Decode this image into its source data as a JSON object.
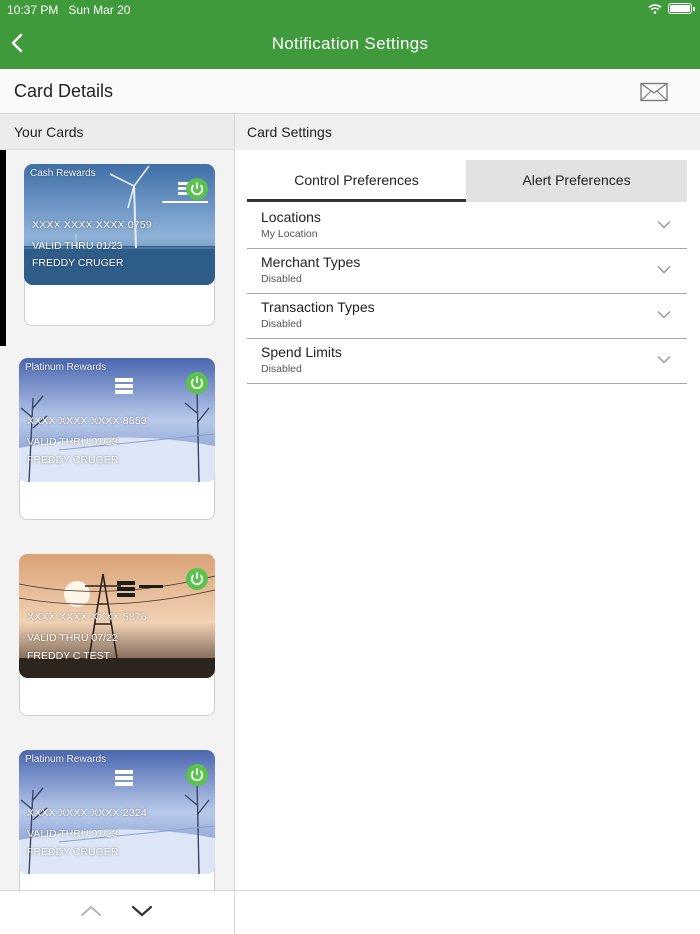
{
  "status_bar": {
    "time": "10:37 PM",
    "date": "Sun Mar 20"
  },
  "nav": {
    "title": "Notification Settings",
    "back_icon": "chevron-left-icon"
  },
  "details": {
    "title": "Card Details",
    "mail_icon": "mail-icon"
  },
  "left": {
    "heading": "Your Cards",
    "cards": [
      {
        "label": "Cash Rewards",
        "number": "XXXX XXXX XXXX 0759",
        "valid": "VALID THRU 01/23",
        "name": "FREDDY CRUGER",
        "theme": "wind-turbine",
        "selected": true
      },
      {
        "label": "Platinum Rewards",
        "number": "XXXX XXXX XXXX 8853",
        "valid": "VALID THRU 01/23",
        "name": "FREDDY CRUGER",
        "theme": "winter",
        "selected": false
      },
      {
        "label": "",
        "number": "XXXX XXXX XXXX 5876",
        "valid": "VALID THRU 07/22",
        "name": "FREDDY C TEST",
        "theme": "power-lines",
        "selected": false
      },
      {
        "label": "Platinum Rewards",
        "number": "XXXX XXXX XXXX 2324",
        "valid": "VALID THRU 01/23",
        "name": "FREDDY CRUGER",
        "theme": "winter",
        "selected": false
      }
    ],
    "footer_icons": [
      "chevron-up-icon",
      "chevron-down-icon"
    ]
  },
  "right": {
    "heading": "Card Settings",
    "tabs": [
      {
        "label": "Control Preferences",
        "active": true
      },
      {
        "label": "Alert Preferences",
        "active": false
      }
    ],
    "preferences": [
      {
        "title": "Locations",
        "value": "My Location"
      },
      {
        "title": "Merchant Types",
        "value": "Disabled"
      },
      {
        "title": "Transaction Types",
        "value": "Disabled"
      },
      {
        "title": "Spend Limits",
        "value": "Disabled"
      }
    ]
  },
  "colors": {
    "accent": "#3e9a3a",
    "power_on": "#5bc24d"
  }
}
